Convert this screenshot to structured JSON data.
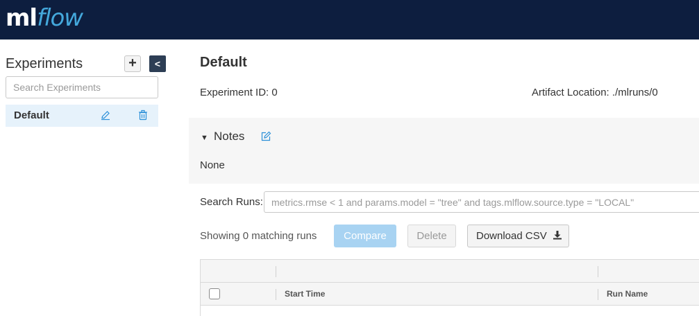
{
  "header": {
    "logo_ml": "ml",
    "logo_flow": "flow"
  },
  "sidebar": {
    "title": "Experiments",
    "add_button": "+",
    "collapse_button": "<",
    "search_placeholder": "Search Experiments",
    "items": [
      {
        "name": "Default",
        "selected": true
      }
    ]
  },
  "main": {
    "title": "Default",
    "experiment_id_label": "Experiment ID:",
    "experiment_id_value": "0",
    "artifact_label": "Artifact Location:",
    "artifact_value": "./mlruns/0",
    "notes": {
      "label": "Notes",
      "value": "None"
    },
    "search_runs": {
      "label": "Search Runs:",
      "placeholder": "metrics.rmse < 1 and params.model = \"tree\" and tags.mlflow.source.type = \"LOCAL\""
    },
    "showing_text": "Showing 0 matching runs",
    "buttons": {
      "compare": "Compare",
      "delete": "Delete",
      "download_csv": "Download CSV"
    },
    "table": {
      "columns": [
        "Start Time",
        "Run Name"
      ]
    }
  },
  "colors": {
    "topbar": "#0d1e3f",
    "accent": "#44a8dc",
    "selected_bg": "#e6f2fb",
    "compare_disabled": "#a8d3f2"
  }
}
